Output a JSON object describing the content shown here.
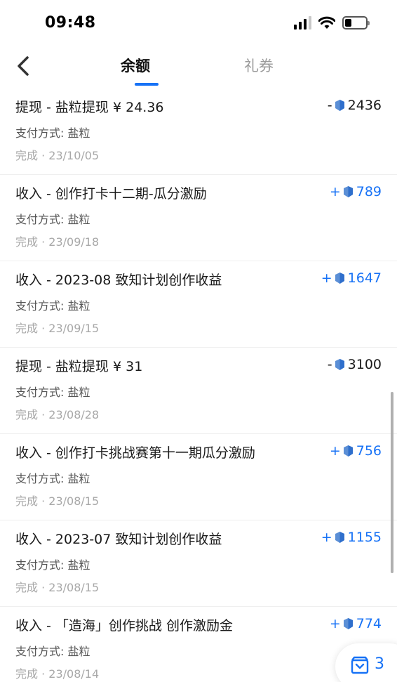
{
  "status_bar": {
    "time": "09:48"
  },
  "header": {
    "tabs": [
      {
        "label": "余额",
        "active": true
      },
      {
        "label": "礼券",
        "active": false
      }
    ]
  },
  "colors": {
    "accent": "#1772f6"
  },
  "transactions": [
    {
      "title": "提现 - 盐粒提现 ¥ 24.36",
      "method": "支付方式: 盐粒",
      "status": "完成 · 23/10/05",
      "sign": "-",
      "amount": "2436",
      "type": "neg"
    },
    {
      "title": "收入 - 创作打卡十二期-瓜分激励",
      "method": "支付方式: 盐粒",
      "status": "完成 · 23/09/18",
      "sign": "+",
      "amount": "789",
      "type": "pos"
    },
    {
      "title": "收入 - 2023-08 致知计划创作收益",
      "method": "支付方式: 盐粒",
      "status": "完成 · 23/09/15",
      "sign": "+",
      "amount": "1647",
      "type": "pos"
    },
    {
      "title": "提现 - 盐粒提现 ¥ 31",
      "method": "支付方式: 盐粒",
      "status": "完成 · 23/08/28",
      "sign": "-",
      "amount": "3100",
      "type": "neg"
    },
    {
      "title": "收入 - 创作打卡挑战赛第十一期瓜分激励",
      "method": "支付方式: 盐粒",
      "status": "完成 · 23/08/15",
      "sign": "+",
      "amount": "756",
      "type": "pos"
    },
    {
      "title": "收入 - 2023-07 致知计划创作收益",
      "method": "支付方式: 盐粒",
      "status": "完成 · 23/08/15",
      "sign": "+",
      "amount": "1155",
      "type": "pos"
    },
    {
      "title": "收入 - 「造海」创作挑战 创作激励金",
      "method": "支付方式: 盐粒",
      "status": "完成 · 23/08/14",
      "sign": "+",
      "amount": "774",
      "type": "pos"
    }
  ],
  "floating_button": {
    "count": "3",
    "icon": "inbox-icon"
  }
}
